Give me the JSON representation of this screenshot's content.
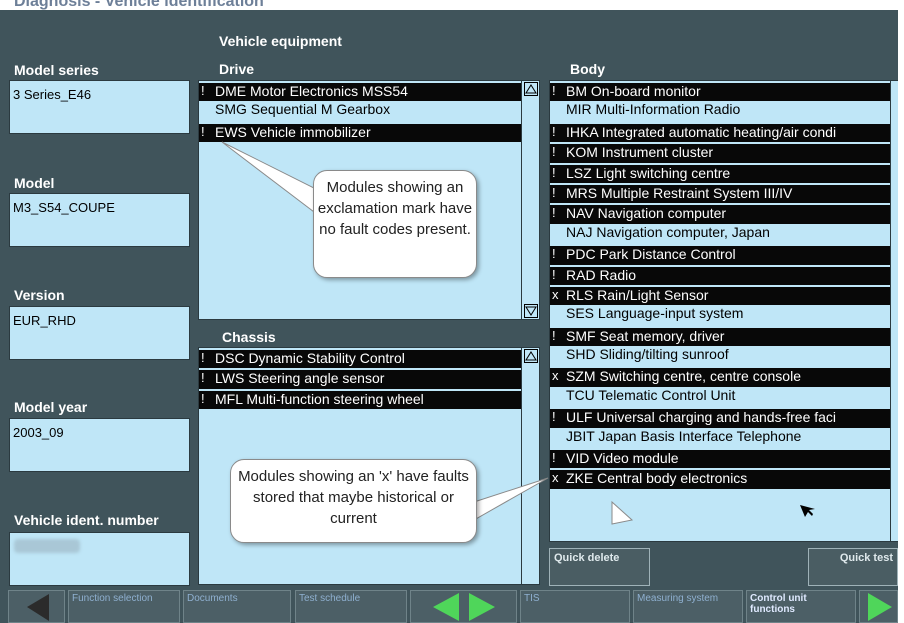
{
  "header": {
    "title": "Diagnosis - Vehicle identification"
  },
  "equipment_title": "Vehicle equipment",
  "left_fields": [
    {
      "label": "Model series",
      "value": "3 Series_E46"
    },
    {
      "label": "Model",
      "value": "M3_S54_COUPE"
    },
    {
      "label": "Version",
      "value": "EUR_RHD"
    },
    {
      "label": "Model year",
      "value": "2003_09"
    },
    {
      "label": "Vehicle ident. number",
      "value": ""
    }
  ],
  "drive": {
    "title": "Drive",
    "items": [
      {
        "mark": "!",
        "label": "DME Motor Electronics MSS54",
        "selected": true
      },
      {
        "mark": "",
        "label": "SMG Sequential M Gearbox",
        "selected": false
      },
      {
        "mark": "!",
        "label": "EWS Vehicle immobilizer",
        "selected": true
      }
    ]
  },
  "chassis": {
    "title": "Chassis",
    "items": [
      {
        "mark": "!",
        "label": "DSC Dynamic Stability Control",
        "selected": true
      },
      {
        "mark": "!",
        "label": "LWS Steering angle sensor",
        "selected": true
      },
      {
        "mark": "!",
        "label": "MFL Multi-function steering wheel",
        "selected": true
      }
    ]
  },
  "body": {
    "title": "Body",
    "items": [
      {
        "mark": "!",
        "label": "BM On-board monitor",
        "selected": true
      },
      {
        "mark": "",
        "label": "MIR Multi-Information Radio",
        "selected": false
      },
      {
        "mark": "!",
        "label": "IHKA Integrated automatic heating/air condi",
        "selected": true
      },
      {
        "mark": "!",
        "label": "KOM Instrument cluster",
        "selected": true
      },
      {
        "mark": "!",
        "label": "LSZ Light switching centre",
        "selected": true
      },
      {
        "mark": "!",
        "label": "MRS Multiple Restraint System III/IV",
        "selected": true
      },
      {
        "mark": "!",
        "label": "NAV Navigation computer",
        "selected": true
      },
      {
        "mark": "",
        "label": "NAJ Navigation computer, Japan",
        "selected": false
      },
      {
        "mark": "!",
        "label": "PDC Park Distance Control",
        "selected": true
      },
      {
        "mark": "!",
        "label": "RAD Radio",
        "selected": true
      },
      {
        "mark": "x",
        "label": "RLS Rain/Light Sensor",
        "selected": true
      },
      {
        "mark": "",
        "label": "SES Language-input system",
        "selected": false
      },
      {
        "mark": "!",
        "label": "SMF Seat memory, driver",
        "selected": true
      },
      {
        "mark": "",
        "label": "SHD Sliding/tilting sunroof",
        "selected": false
      },
      {
        "mark": "x",
        "label": "SZM Switching centre, centre console",
        "selected": true
      },
      {
        "mark": "",
        "label": "TCU Telematic Control Unit",
        "selected": false
      },
      {
        "mark": "!",
        "label": "ULF Universal charging and hands-free faci",
        "selected": true
      },
      {
        "mark": "",
        "label": "JBIT Japan Basis Interface Telephone",
        "selected": false
      },
      {
        "mark": "!",
        "label": "VID Video module",
        "selected": true
      },
      {
        "mark": "x",
        "label": "ZKE Central body electronics",
        "selected": true
      }
    ]
  },
  "callouts": [
    {
      "text": "Modules showing an exclamation mark have no fault codes present."
    },
    {
      "text": "Modules showing an 'x' have faults stored that maybe historical or current"
    }
  ],
  "buttons": {
    "quick_delete": "Quick delete",
    "quick_test": "Quick test"
  },
  "bottom_nav": [
    {
      "label": "Function selection"
    },
    {
      "label": "Documents"
    },
    {
      "label": "Test schedule"
    },
    {
      "label": "TIS"
    },
    {
      "label": "Measuring system"
    },
    {
      "label": "Control unit functions"
    }
  ],
  "colors": {
    "background": "#40545b",
    "field": "#bfe6f7",
    "selected_row": "#080808",
    "nav_arrow": "#4fd65a"
  }
}
